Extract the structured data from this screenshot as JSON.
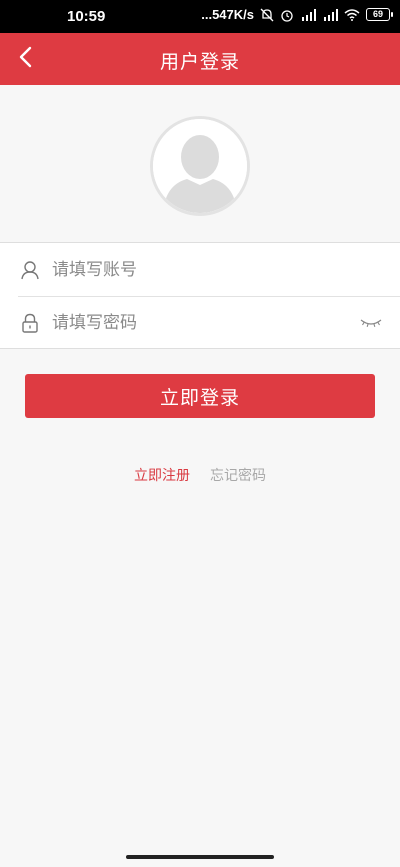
{
  "status_bar": {
    "time": "10:59",
    "network_speed": "...547K/s",
    "battery": "69",
    "icons": [
      "mute-icon",
      "alarm-icon",
      "signal-hd-icon",
      "signal-icon",
      "wifi-icon",
      "battery-icon"
    ]
  },
  "header": {
    "title": "用户登录",
    "back_icon": "chevron-left-icon",
    "background": "#de3b42"
  },
  "avatar": {
    "icon": "default-user-avatar-icon"
  },
  "form": {
    "account": {
      "placeholder": "请填写账号",
      "value": "",
      "icon": "user-icon"
    },
    "password": {
      "placeholder": "请填写密码",
      "value": "",
      "icon": "lock-icon",
      "toggle_icon": "eye-closed-icon"
    }
  },
  "actions": {
    "login_label": "立即登录",
    "register_label": "立即注册",
    "forgot_label": "忘记密码"
  },
  "colors": {
    "accent": "#de3b42",
    "link_secondary": "#a8a8a8",
    "background": "#f7f7f7"
  }
}
